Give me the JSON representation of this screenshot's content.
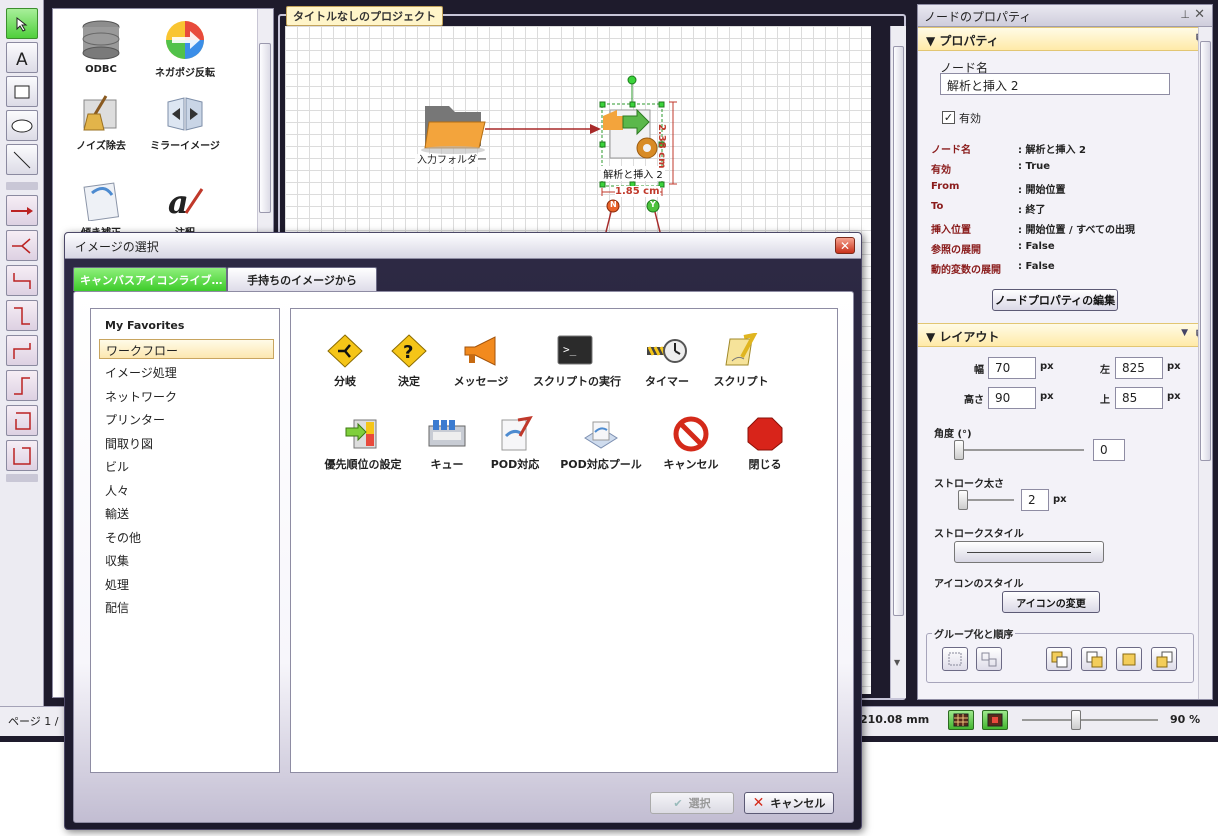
{
  "canvas": {
    "title": "タイトルなしのプロジェクト"
  },
  "palette": {
    "items": [
      {
        "label": "ODBC",
        "icon": "database-icon"
      },
      {
        "label": "ネガポジ反転",
        "icon": "color-wheel-icon"
      },
      {
        "label": "ノイズ除去",
        "icon": "broom-icon"
      },
      {
        "label": "ミラーイメージ",
        "icon": "mirror-icon"
      },
      {
        "label": "傾き補正",
        "icon": "deskew-icon"
      },
      {
        "label": "注釈",
        "icon": "annotation-icon"
      }
    ]
  },
  "diagram": {
    "node1": "入力フォルダー",
    "node2": "解析と挿入 2",
    "dim_height": "2.38 cm",
    "dim_width": "1.85 cm",
    "port_n": "N",
    "port_y": "Y"
  },
  "status": {
    "page": "ページ 1 /",
    "coord": "210.08 mm",
    "zoom": "90 %",
    "zoom_level": 0.4
  },
  "props": {
    "header": "ノードのプロパティ",
    "section": "プロパティ",
    "node_name_label": "ノード名",
    "node_name_value": "解析と挿入 2",
    "enabled_label": "有効",
    "rows": [
      {
        "k": "ノード名",
        "v": ": 解析と挿入 2"
      },
      {
        "k": "有効",
        "v": ": True"
      },
      {
        "k": "From",
        "v": ": 開始位置"
      },
      {
        "k": "To",
        "v": ": 終了"
      },
      {
        "k": "挿入位置",
        "v": ": 開始位置 / すべての出現"
      },
      {
        "k": "参照の展開",
        "v": ": False"
      },
      {
        "k": "動的変数の展開",
        "v": ": False"
      }
    ],
    "edit_button": "ノードプロパティの編集"
  },
  "layout": {
    "section": "レイアウト",
    "width_label": "幅",
    "width_value": "70",
    "left_label": "左",
    "left_value": "825",
    "height_label": "高さ",
    "height_value": "90",
    "top_label": "上",
    "top_value": "85",
    "unit": "px",
    "angle_label": "角度 (°)",
    "angle_value": "0",
    "stroke_label": "ストローク太さ",
    "stroke_value": "2",
    "stroke_style_label": "ストロークスタイル",
    "icon_style_label": "アイコンのスタイル",
    "change_icon_button": "アイコンの変更",
    "group_label": "グループ化と順序"
  },
  "dialog": {
    "title": "イメージの選択",
    "tab1": "キャンバスアイコンライブ…",
    "tab2": "手持ちのイメージから",
    "favorites": "My Favorites",
    "categories": [
      "ワークフロー",
      "イメージ処理",
      "ネットワーク",
      "プリンター",
      "間取り図",
      "ビル",
      "人々",
      "輸送",
      "その他",
      "収集",
      "処理",
      "配信"
    ],
    "icons": [
      {
        "label": "分岐",
        "icon": "branch-icon"
      },
      {
        "label": "決定",
        "icon": "decision-icon"
      },
      {
        "label": "メッセージ",
        "icon": "megaphone-icon"
      },
      {
        "label": "スクリプトの実行",
        "icon": "terminal-icon"
      },
      {
        "label": "タイマー",
        "icon": "timer-icon"
      },
      {
        "label": "スクリプト",
        "icon": "script-icon"
      },
      {
        "label": "優先順位の設定",
        "icon": "priority-icon"
      },
      {
        "label": "キュー",
        "icon": "queue-icon"
      },
      {
        "label": "POD対応",
        "icon": "pod-icon"
      },
      {
        "label": "POD対応プール",
        "icon": "pod-pool-icon"
      },
      {
        "label": "キャンセル",
        "icon": "cancel-icon"
      },
      {
        "label": "閉じる",
        "icon": "stop-icon"
      }
    ],
    "select_button": "選択",
    "cancel_button": "キャンセル"
  }
}
